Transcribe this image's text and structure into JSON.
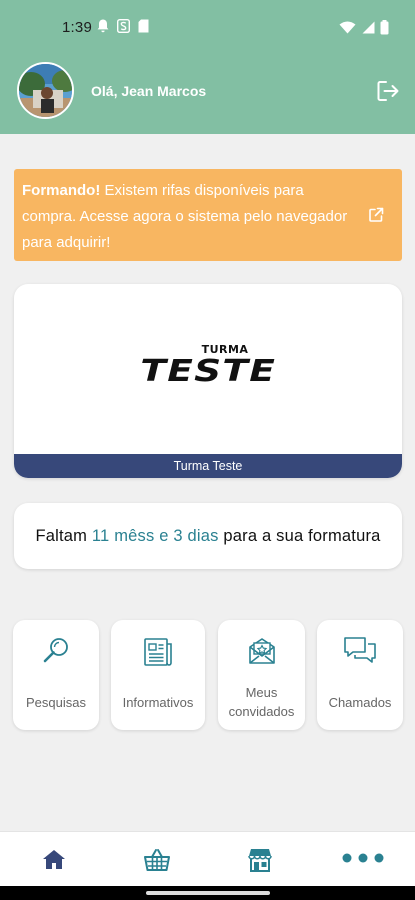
{
  "status_bar": {
    "time": "1:39"
  },
  "header": {
    "greeting": "Olá, Jean Marcos"
  },
  "alert": {
    "bold": "Formando!",
    "text": " Existem rifas disponíveis para compra. Acesse agora o sistema pelo navegador para adquirir!"
  },
  "class_card": {
    "logo_small": "TURMA",
    "logo_big": "TESTE",
    "name": "Turma Teste"
  },
  "countdown": {
    "prefix": "Faltam ",
    "highlight": "11 mêss e 3 dias",
    "suffix": " para a sua formatura"
  },
  "tiles": [
    {
      "label": "Pesquisas"
    },
    {
      "label": "Informativos"
    },
    {
      "label_line1": "Meus",
      "label_line2": "convidados"
    },
    {
      "label": "Chamados"
    }
  ],
  "colors": {
    "header_green": "#82bfa3",
    "alert_orange": "#f8b661",
    "navy": "#37487a",
    "teal": "#2a8191"
  },
  "icons": {
    "nav": [
      "home-icon",
      "basket-icon",
      "store-icon",
      "more-icon"
    ]
  }
}
